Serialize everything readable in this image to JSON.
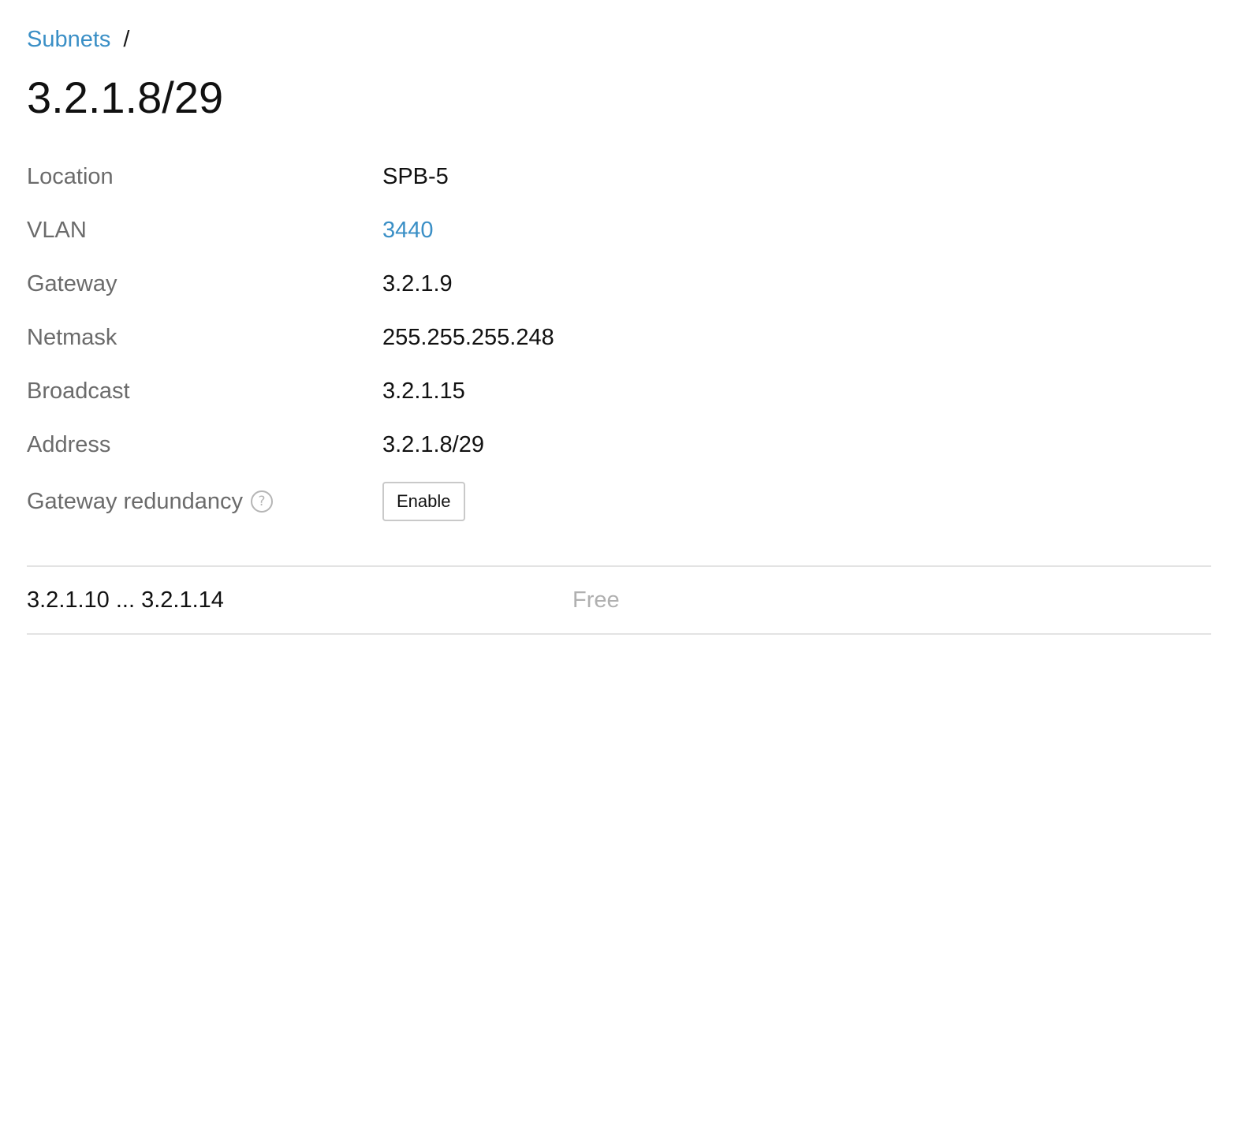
{
  "breadcrumb": {
    "parent_label": "Subnets",
    "separator": "/"
  },
  "page": {
    "title": "3.2.1.8/29"
  },
  "properties": [
    {
      "label": "Location",
      "value": "SPB-5",
      "is_link": false
    },
    {
      "label": "VLAN",
      "value": "3440",
      "is_link": true
    },
    {
      "label": "Gateway",
      "value": "3.2.1.9",
      "is_link": false
    },
    {
      "label": "Netmask",
      "value": "255.255.255.248",
      "is_link": false
    },
    {
      "label": "Broadcast",
      "value": "3.2.1.15",
      "is_link": false
    },
    {
      "label": "Address",
      "value": "3.2.1.8/29",
      "is_link": false
    }
  ],
  "gateway_redundancy": {
    "label": "Gateway redundancy",
    "help_icon": "question-circle-icon",
    "help_glyph": "?",
    "button_label": "Enable"
  },
  "ranges": [
    {
      "range": "3.2.1.10 ... 3.2.1.14",
      "status": "Free"
    }
  ],
  "colors": {
    "link": "#3a8fc6",
    "label": "#6b6b6b",
    "muted": "#b0b0b0",
    "divider": "#e3e3e3"
  }
}
